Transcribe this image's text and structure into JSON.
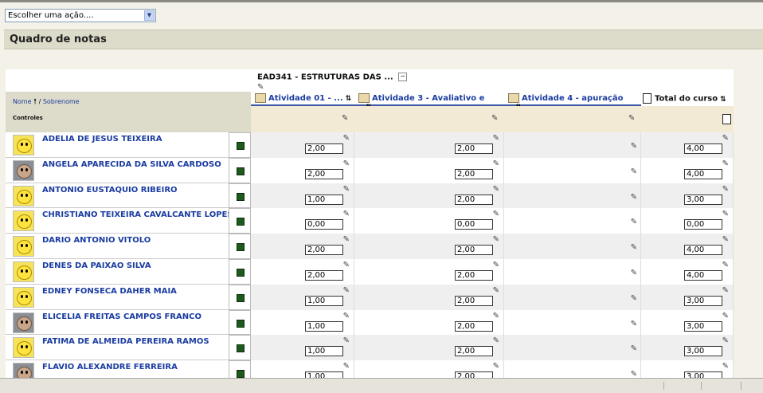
{
  "action_select": {
    "value": "Escolher uma ação...."
  },
  "page_title": "Quadro de notas",
  "course": {
    "title": "EAD341 - ESTRUTURAS DAS ..."
  },
  "name_header": {
    "first": "Nome",
    "separator": " / ",
    "last": "Sobrenome",
    "sort_glyph": "🠕"
  },
  "columns": [
    {
      "label": "Atividade 01 - ...",
      "icon": "assignment-icon"
    },
    {
      "label": "Atividade 3 - Avaliativo e ...",
      "icon": "assignment-icon"
    },
    {
      "label": "Atividade 4 - apuração ...",
      "icon": "assignment-icon"
    },
    {
      "label": "Total do curso",
      "icon": "calculator-icon"
    }
  ],
  "controls_label": "Controles",
  "students": [
    {
      "name": "ADELIA DE JESUS TEIXEIRA",
      "avatar": "smiley",
      "grades": [
        "2,00",
        "2,00",
        "",
        "4,00"
      ]
    },
    {
      "name": "ANGELA APARECIDA DA SILVA CARDOSO",
      "avatar": "photo",
      "grades": [
        "2,00",
        "2,00",
        "",
        "4,00"
      ]
    },
    {
      "name": "ANTONIO EUSTAQUIO RIBEIRO",
      "avatar": "smiley",
      "grades": [
        "1,00",
        "2,00",
        "",
        "3,00"
      ]
    },
    {
      "name": "CHRISTIANO TEIXEIRA CAVALCANTE LOPES",
      "avatar": "smiley",
      "grades": [
        "0,00",
        "0,00",
        "",
        "0,00"
      ]
    },
    {
      "name": "DARIO ANTONIO VITOLO",
      "avatar": "smiley",
      "grades": [
        "2,00",
        "2,00",
        "",
        "4,00"
      ]
    },
    {
      "name": "DENES DA PAIXAO SILVA",
      "avatar": "smiley",
      "grades": [
        "2,00",
        "2,00",
        "",
        "4,00"
      ]
    },
    {
      "name": "EDNEY FONSECA DAHER MAIA",
      "avatar": "smiley",
      "grades": [
        "1,00",
        "2,00",
        "",
        "3,00"
      ]
    },
    {
      "name": "ELICELIA FREITAS CAMPOS FRANCO",
      "avatar": "photo",
      "grades": [
        "1,00",
        "2,00",
        "",
        "3,00"
      ]
    },
    {
      "name": "FATIMA DE ALMEIDA PEREIRA RAMOS",
      "avatar": "smiley",
      "grades": [
        "1,00",
        "2,00",
        "",
        "3,00"
      ]
    },
    {
      "name": "FLAVIO ALEXANDRE FERREIRA",
      "avatar": "photo",
      "grades": [
        "1,00",
        "2,00",
        "",
        "3,00"
      ]
    }
  ]
}
